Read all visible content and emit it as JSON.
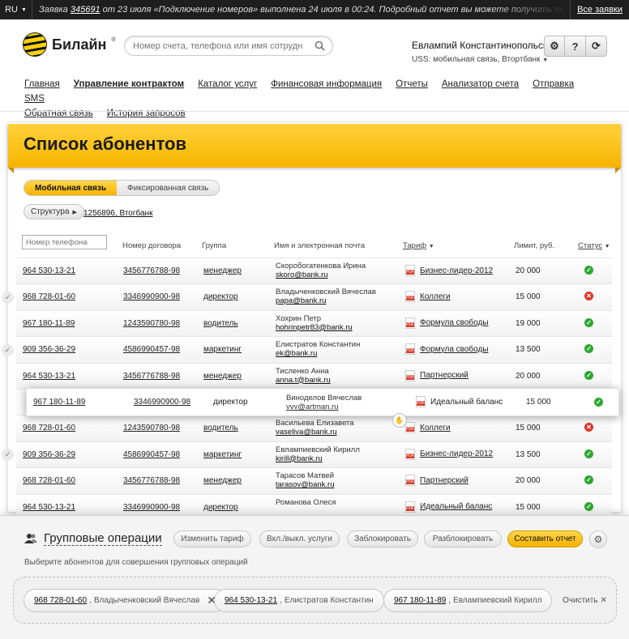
{
  "topbar": {
    "lang": "RU",
    "msg_pre": "Заявка",
    "msg_id": "345691",
    "msg_post": "от 23 июля «Подключение номеров» выполнена 24 июля в 00:24. Подробный отчет вы можете получить по телефону",
    "all_requests": "Все заявки"
  },
  "header": {
    "brand": "Билайн",
    "search_placeholder": "Номер счета, телефона или имя сотрудника",
    "user_name": "Евлампий Константинопольский",
    "user_sub": "USS: мобильная связь, Втортбанк",
    "help": "?"
  },
  "nav": [
    "Главная",
    "Управление контрактом",
    "Каталог услуг",
    "Финансовая информация",
    "Отчеты",
    "Анализатор счета",
    "Отправка SMS",
    "Обратная связь",
    "История запросов"
  ],
  "page": {
    "title": "Список абонентов",
    "tab_mobile": "Мобильная связь",
    "tab_fixed": "Фиксированная связь",
    "structure": "Структура",
    "crumb": "1256896, Втогбанк"
  },
  "table": {
    "phone_placeholder": "Номер телефона",
    "headers": [
      "Номер договора",
      "Группа",
      "Имя и электронная почта",
      "Тариф",
      "Лимит, руб.",
      "Статус"
    ],
    "rows": [
      {
        "phone": "964 530-13-21",
        "contract": "3456776788-98",
        "group": "менеджер",
        "name": "Скоробогатенкова Ирина",
        "email": "skoro@bank.ru",
        "tariff": "Бизнес-лидер-2012",
        "limit": "20 000",
        "status": "ok"
      },
      {
        "phone": "968 728-01-60",
        "contract": "3346990900-98",
        "group": "директор",
        "name": "Владыченковский Вячеслав",
        "email": "papa@bank.ru",
        "tariff": "Коллеги",
        "limit": "15 000",
        "status": "no"
      },
      {
        "phone": "967 180-11-89",
        "contract": "1243590780-98",
        "group": "водитель",
        "name": "Хохрин Петр",
        "email": "hohrinpetr83@bank.ru",
        "tariff": "Формула свободы",
        "limit": "19 000",
        "status": "ok"
      },
      {
        "phone": "909 356-36-29",
        "contract": "4586990457-98",
        "group": "маркетинг",
        "name": "Елистратов Константин",
        "email": "ek@bank.ru",
        "tariff": "Формула свободы",
        "limit": "13 500",
        "status": "ok"
      },
      {
        "phone": "964 530-13-21",
        "contract": "3456776788-98",
        "group": "менеджер",
        "name": "Тисленко Анна",
        "email": "anna.t@bank.ru",
        "tariff": "Партнерский",
        "limit": "20 000",
        "status": "ok"
      },
      {
        "phone": "",
        "contract": "",
        "group": "",
        "name": "",
        "email": "",
        "tariff": "",
        "limit": "",
        "status": ""
      },
      {
        "phone": "968 728-01-60",
        "contract": "1243590780-98",
        "group": "водитель",
        "name": "Васильева Елизавета",
        "email": "vaseliva@bank.ru",
        "tariff": "Коллеги",
        "limit": "15 000",
        "status": "no"
      },
      {
        "phone": "909 356-36-29",
        "contract": "4586990457-98",
        "group": "маркетинг",
        "name": "Евлампиевский Кирилл",
        "email": "kirill@bank.ru",
        "tariff": "Бизнес-лидер-2012",
        "limit": "13 500",
        "status": "ok"
      },
      {
        "phone": "968 728-01-60",
        "contract": "3456776788-98",
        "group": "менеджер",
        "name": "Тарасов Матвей",
        "email": "tarasov@bank.ru",
        "tariff": "Партнерский",
        "limit": "20 000",
        "status": "ok"
      },
      {
        "phone": "964 530-13-21",
        "contract": "3346990900-98",
        "group": "директор",
        "name": "Романова Олеся",
        "email": "",
        "tariff": "Идеальный баланс",
        "limit": "15 000",
        "status": "ok"
      }
    ],
    "dragged": {
      "phone": "967 180-11-89",
      "contract": "3346990900-98",
      "group": "директор",
      "name": "Виноделов Вячеслав",
      "email": "vvv@artman.ru",
      "tariff": "Идеальный баланс",
      "limit": "15 000"
    }
  },
  "group_ops": {
    "title": "Групповые операции",
    "buttons": [
      "Изменить тариф",
      "Вкл./выкл. услуги",
      "Заблокировать",
      "Разблокировать",
      "Составить отчет"
    ],
    "hint": "Выберите абонентов для совершения групповых операций",
    "chips": [
      {
        "phone": "968 728-01-60",
        "name": "Владыченковский Вячеслав"
      },
      {
        "phone": "964 530-13-21",
        "name": "Елистратов Константин"
      },
      {
        "phone": "967 180-11-89",
        "name": "Евлампиевский Кирилл"
      }
    ],
    "clear": "Очистить"
  }
}
